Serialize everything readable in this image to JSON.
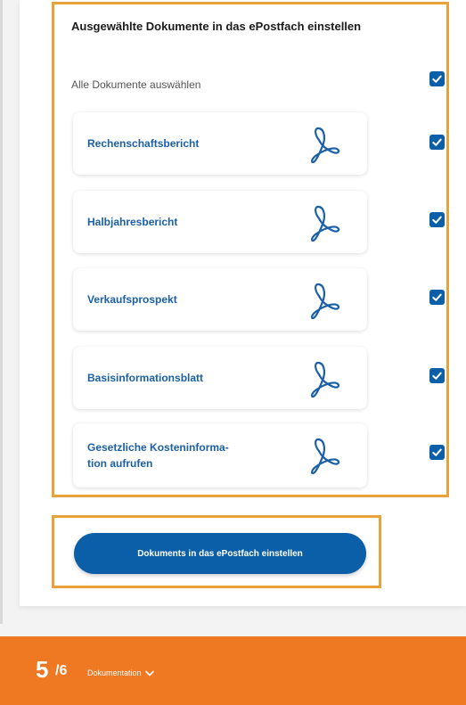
{
  "documents_section": {
    "title": "Ausgewählte Dokumente in das ePostfach einstellen",
    "select_all_label": "Alle Dokumente auswählen",
    "select_all_checked": true,
    "items": [
      {
        "label": "Rechenschaftsbericht",
        "icon": "pdf-icon",
        "checked": true
      },
      {
        "label": "Halbjahresbericht",
        "icon": "pdf-icon",
        "checked": true
      },
      {
        "label": "Verkaufsprospekt",
        "icon": "pdf-icon",
        "checked": true
      },
      {
        "label": "Basisinformationsblatt",
        "icon": "pdf-icon",
        "checked": true
      },
      {
        "label": "Gesetzliche Kosteninforma-\ntion aufrufen",
        "icon": "pdf-icon",
        "checked": true
      }
    ]
  },
  "primary_action": {
    "label": "Dokuments in das ePostfach einstellen"
  },
  "footer": {
    "step_current": "5",
    "step_total": "/6",
    "section_label": "Dokumentation",
    "chevron_icon": "chevron-down-icon"
  },
  "colors": {
    "brand_blue": "#0b5fa8",
    "link_blue": "#1a5fa7",
    "footer_orange": "#ef7822",
    "highlight_orange": "#e8a13b"
  }
}
